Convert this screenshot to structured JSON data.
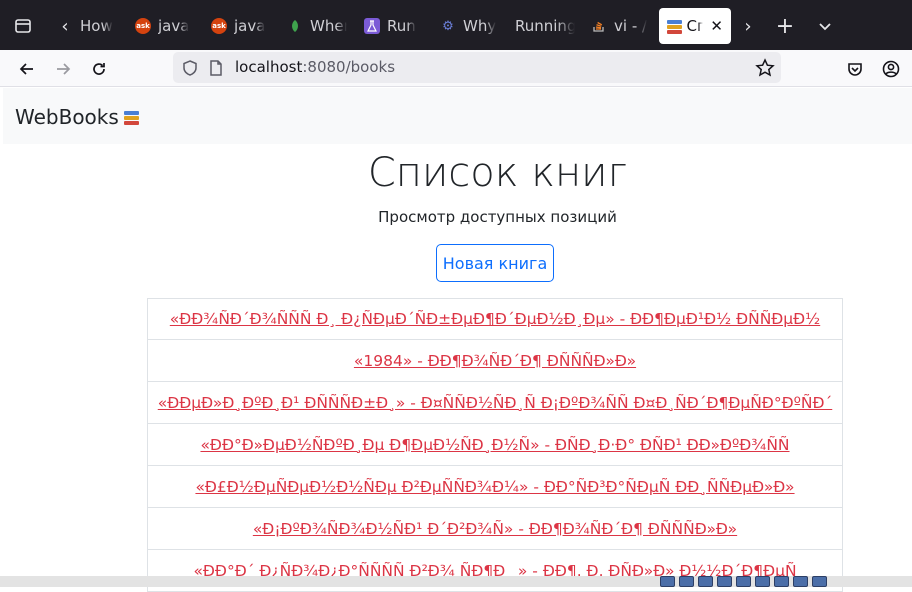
{
  "browser": {
    "tabs": [
      {
        "label": "How",
        "favicon": "none",
        "color": ""
      },
      {
        "label": "java",
        "favicon": "ask-icon",
        "color": "#d4430f"
      },
      {
        "label": "java",
        "favicon": "ask-icon",
        "color": "#d4430f"
      },
      {
        "label": "When",
        "favicon": "leaf-icon",
        "color": "#3fa34d"
      },
      {
        "label": "Run",
        "favicon": "flask-icon",
        "color": "#7b5bd6"
      },
      {
        "label": "Why",
        "favicon": "gear-icon",
        "color": "#6b7fd9"
      },
      {
        "label": "Running",
        "favicon": "none",
        "color": ""
      },
      {
        "label": "vi - /",
        "favicon": "stack-icon",
        "color": "#f48024"
      },
      {
        "label": "Сп",
        "favicon": "books-icon",
        "color": "",
        "active": true
      }
    ],
    "url_host": "localhost",
    "url_rest": ":8080/books"
  },
  "site": {
    "brand": "WebBooks",
    "title": "Список книг",
    "subtitle": "Просмотр доступных позиций",
    "new_book_label": "Новая книга"
  },
  "books": [
    "«ÐÐ¾ÑÐ´Ð¾ÑÑÑ Ð¸ Ð¿ÑÐµÐ´ÑÐ±ÐµÐ¶Ð´ÐµÐ½Ð¸Ðµ» - ÐÐ¶ÐµÐ¹Ð½ ÐÑÑÐµÐ½",
    "«1984» - ÐÐ¶Ð¾ÑÐ´Ð¶ ÐÑÑÑÐ»Ð»",
    "«ÐÐµÐ»Ð¸ÐºÐ¸Ð¹ ÐÑÑÑÐ±Ð¸» - Ð¤ÑÑÐ½ÑÐ¸Ñ Ð¡ÐºÐ¾ÑÑ Ð¤Ð¸ÑÐ´Ð¶ÐµÑÐ°ÐºÑÐ´",
    "«ÐÐ°Ð»ÐµÐ½ÑÐºÐ¸Ðµ Ð¶ÐµÐ½ÑÐ¸Ð½Ñ» - ÐÑÐ¸Ð·Ð° ÐÑÐ¹ ÐÐ»ÐºÐ¾ÑÑ",
    "«Ð£Ð½ÐµÑÐµÐ½Ð½ÑÐµ Ð²ÐµÑÑÐ¾Ð¼» - ÐÐ°ÑÐ³Ð°ÑÐµÑ ÐÐ¸ÑÑÐµÐ»Ð»",
    "«Ð¡ÐºÐ¾ÑÐ¾Ð½ÑÐ¹ Ð´Ð²Ð¾Ñ» - ÐÐ¶Ð¾ÑÐ´Ð¶ ÐÑÑÑÐ»Ð»",
    "«ÐÐ°Ð´ Ð¿ÑÐ¾Ð¿Ð°ÑÑÑÑ Ð²Ð¾ ÑÐ¶Ð¸ » - ÐÐ¶. Ð. ÐÑÐ»Ð» Ð½½Ð´Ð¶ÐµÑ"
  ],
  "colors": {
    "tabbar_bg": "#1f1e25",
    "link_red": "#dc3545",
    "primary_blue": "#0d6efd"
  }
}
